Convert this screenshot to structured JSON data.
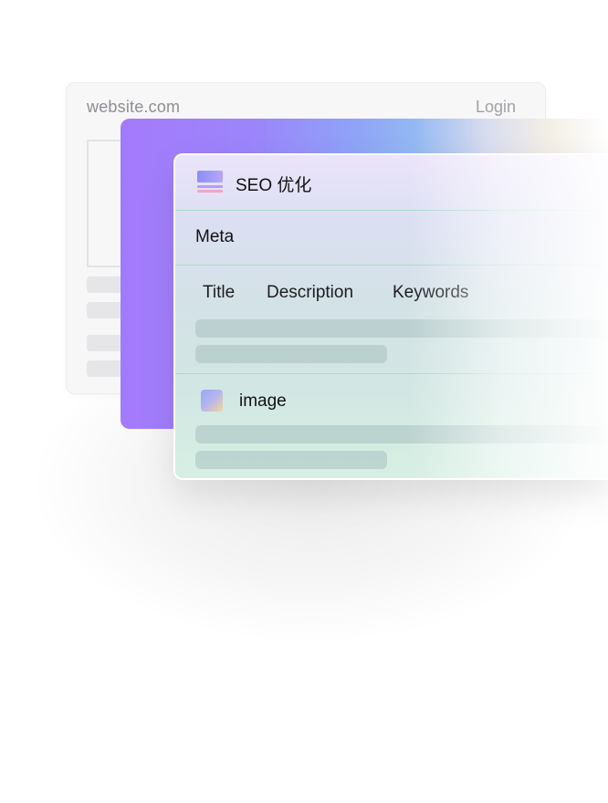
{
  "website_mockup": {
    "domain": "website.com",
    "login_label": "Login"
  },
  "seo_panel": {
    "title": "SEO 优化",
    "icon": "seo-card-icon",
    "meta_section": {
      "label": "Meta",
      "tabs": [
        {
          "label": "Title"
        },
        {
          "label": "Description"
        },
        {
          "label": "Keywords"
        }
      ]
    },
    "image_section": {
      "label": "image",
      "icon": "image-icon"
    }
  },
  "colors": {
    "accent_purple": "#a47afc",
    "accent_blue": "#8fa3f7",
    "divider_green": "#a9dcc6"
  }
}
